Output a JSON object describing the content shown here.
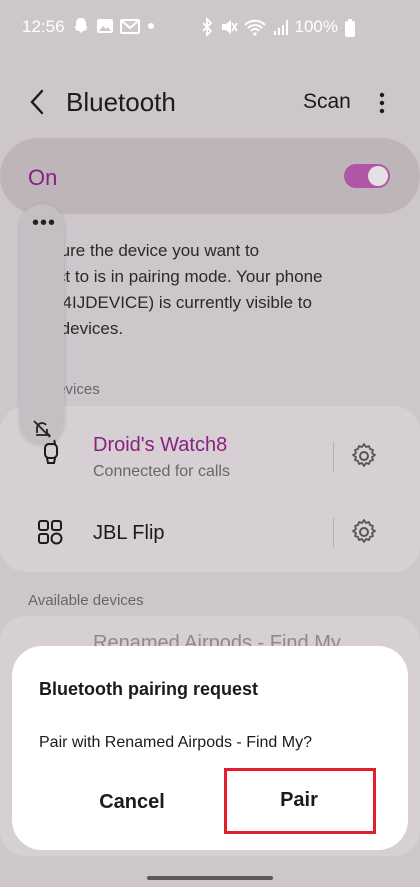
{
  "status_bar": {
    "time": "12:56",
    "battery_pct": "100%",
    "left_icons": [
      "snapchat-icon",
      "image-icon",
      "gmail-icon",
      "dot-icon"
    ],
    "right_icons": [
      "bluetooth-icon",
      "mute-icon",
      "wifi-icon",
      "signal-icon",
      "battery-icon"
    ]
  },
  "header": {
    "title": "Bluetooth",
    "scan_label": "Scan"
  },
  "toggle": {
    "label": "On",
    "state": true
  },
  "info": {
    "text": "e sure the device you want to\nnect to is in pairing mode. Your phone\nBO4IJDEVICE) is currently visible to\nby devices."
  },
  "sections": {
    "paired_header": "ed devices",
    "available_header": "Available devices"
  },
  "paired_devices": [
    {
      "name": "Droid's Watch8",
      "status": "Connected for calls",
      "icon": "watch-icon",
      "name_color": "#8a1f80"
    },
    {
      "name": "JBL Flip",
      "status": "",
      "icon": "speaker-grid-icon",
      "name_color": "#1b1b1b"
    }
  ],
  "available_peek": "Renamed Airpods - Find My",
  "side_panel": {
    "dots": "•••"
  },
  "dialog": {
    "title": "Bluetooth pairing request",
    "message": "Pair with Renamed Airpods - Find My?",
    "cancel_label": "Cancel",
    "pair_label": "Pair"
  },
  "colors": {
    "accent": "#8a1f80",
    "toggle": "#b156a4",
    "highlight": "#e21e2e"
  }
}
